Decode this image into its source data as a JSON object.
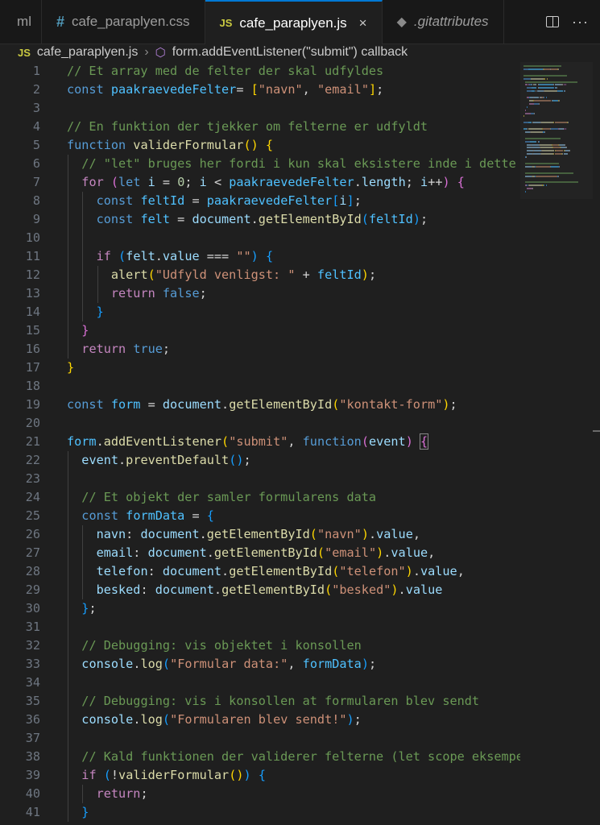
{
  "tabs": [
    {
      "label": "ml"
    },
    {
      "label": "cafe_paraplyen.css",
      "icon": "css-file-icon"
    },
    {
      "label": "cafe_paraplyen.js",
      "icon": "js-file-icon",
      "active": true
    },
    {
      "label": ".gitattributes",
      "icon": "git-file-icon"
    }
  ],
  "icons": {
    "css": "#",
    "js": "JS",
    "close": "×",
    "git": "◆",
    "more": "···",
    "cube": "⬡",
    "chevron": "›"
  },
  "breadcrumb": {
    "file": "cafe_paraplyen.js",
    "symbol": "form.addEventListener(\"submit\") callback"
  },
  "colors": {
    "accent": "#0078d4",
    "background": "#1f1f1f",
    "comment": "#6a9955",
    "keyword": "#569cd6",
    "string": "#ce9178"
  },
  "code": [
    {
      "n": "1",
      "t": [
        [
          "c",
          "// Et array med de felter der skal udfyldes"
        ]
      ]
    },
    {
      "n": "2",
      "t": [
        [
          "k",
          "const "
        ],
        [
          "cn",
          "paakraevedeFelter"
        ],
        [
          "",
          "= "
        ],
        [
          "p1",
          "["
        ],
        [
          "s",
          "\"navn\""
        ],
        [
          "",
          ", "
        ],
        [
          "s",
          "\"email\""
        ],
        [
          "p1",
          "]"
        ],
        [
          "",
          ";"
        ]
      ]
    },
    {
      "n": "3",
      "t": []
    },
    {
      "n": "4",
      "t": [
        [
          "c",
          "// En funktion der tjekker om felterne er udfyldt"
        ]
      ]
    },
    {
      "n": "5",
      "t": [
        [
          "k",
          "function "
        ],
        [
          "f",
          "validerFormular"
        ],
        [
          "p1",
          "()"
        ],
        [
          "",
          " "
        ],
        [
          "p1",
          "{"
        ]
      ]
    },
    {
      "n": "6",
      "g": [
        1
      ],
      "t": [
        [
          "",
          "  "
        ],
        [
          "c",
          "// \"let\" bruges her fordi i kun skal eksistere inde i dette"
        ]
      ]
    },
    {
      "n": "7",
      "g": [
        1
      ],
      "t": [
        [
          "",
          "  "
        ],
        [
          "kw",
          "for "
        ],
        [
          "p2",
          "("
        ],
        [
          "k",
          "let "
        ],
        [
          "v",
          "i"
        ],
        [
          "",
          " = "
        ],
        [
          "n",
          "0"
        ],
        [
          "",
          "; "
        ],
        [
          "v",
          "i"
        ],
        [
          "",
          " < "
        ],
        [
          "cn",
          "paakraevedeFelter"
        ],
        [
          "",
          "."
        ],
        [
          "v",
          "length"
        ],
        [
          "",
          "; "
        ],
        [
          "v",
          "i"
        ],
        [
          "",
          "++"
        ],
        [
          "p2",
          ")"
        ],
        [
          "",
          " "
        ],
        [
          "p2",
          "{"
        ]
      ]
    },
    {
      "n": "8",
      "g": [
        1,
        2
      ],
      "t": [
        [
          "",
          "    "
        ],
        [
          "k",
          "const "
        ],
        [
          "cn",
          "feltId"
        ],
        [
          "",
          " = "
        ],
        [
          "cn",
          "paakraevedeFelter"
        ],
        [
          "p3",
          "["
        ],
        [
          "v",
          "i"
        ],
        [
          "p3",
          "]"
        ],
        [
          "",
          ";"
        ]
      ]
    },
    {
      "n": "9",
      "g": [
        1,
        2
      ],
      "t": [
        [
          "",
          "    "
        ],
        [
          "k",
          "const "
        ],
        [
          "cn",
          "felt"
        ],
        [
          "",
          " = "
        ],
        [
          "v",
          "document"
        ],
        [
          "",
          "."
        ],
        [
          "f",
          "getElementById"
        ],
        [
          "p3",
          "("
        ],
        [
          "cn",
          "feltId"
        ],
        [
          "p3",
          ")"
        ],
        [
          "",
          ";"
        ]
      ]
    },
    {
      "n": "10",
      "g": [
        1,
        2
      ],
      "t": []
    },
    {
      "n": "11",
      "g": [
        1,
        2
      ],
      "t": [
        [
          "",
          "    "
        ],
        [
          "kw",
          "if "
        ],
        [
          "p3",
          "("
        ],
        [
          "v",
          "felt"
        ],
        [
          "",
          "."
        ],
        [
          "v",
          "value"
        ],
        [
          "",
          " === "
        ],
        [
          "s",
          "\"\""
        ],
        [
          "p3",
          ")"
        ],
        [
          "",
          " "
        ],
        [
          "p3",
          "{"
        ]
      ]
    },
    {
      "n": "12",
      "g": [
        1,
        2,
        3
      ],
      "t": [
        [
          "",
          "      "
        ],
        [
          "f",
          "alert"
        ],
        [
          "p1",
          "("
        ],
        [
          "s",
          "\"Udfyld venligst: \""
        ],
        [
          "",
          " + "
        ],
        [
          "cn",
          "feltId"
        ],
        [
          "p1",
          ")"
        ],
        [
          "",
          ";"
        ]
      ]
    },
    {
      "n": "13",
      "g": [
        1,
        2,
        3
      ],
      "t": [
        [
          "",
          "      "
        ],
        [
          "kw",
          "return "
        ],
        [
          "k",
          "false"
        ],
        [
          "",
          ";"
        ]
      ]
    },
    {
      "n": "14",
      "g": [
        1,
        2
      ],
      "t": [
        [
          "",
          "    "
        ],
        [
          "p3",
          "}"
        ]
      ]
    },
    {
      "n": "15",
      "g": [
        1
      ],
      "t": [
        [
          "",
          "  "
        ],
        [
          "p2",
          "}"
        ]
      ]
    },
    {
      "n": "16",
      "g": [
        1
      ],
      "t": [
        [
          "",
          "  "
        ],
        [
          "kw",
          "return "
        ],
        [
          "k",
          "true"
        ],
        [
          "",
          ";"
        ]
      ]
    },
    {
      "n": "17",
      "t": [
        [
          "p1",
          "}"
        ]
      ]
    },
    {
      "n": "18",
      "t": []
    },
    {
      "n": "19",
      "t": [
        [
          "k",
          "const "
        ],
        [
          "cn",
          "form"
        ],
        [
          "",
          " = "
        ],
        [
          "v",
          "document"
        ],
        [
          "",
          "."
        ],
        [
          "f",
          "getElementById"
        ],
        [
          "p1",
          "("
        ],
        [
          "s",
          "\"kontakt-form\""
        ],
        [
          "p1",
          ")"
        ],
        [
          "",
          ";"
        ]
      ]
    },
    {
      "n": "20",
      "t": []
    },
    {
      "n": "21",
      "t": [
        [
          "cn",
          "form"
        ],
        [
          "",
          "."
        ],
        [
          "f",
          "addEventListener"
        ],
        [
          "p1",
          "("
        ],
        [
          "s",
          "\"submit\""
        ],
        [
          "",
          ", "
        ],
        [
          "k",
          "function"
        ],
        [
          "p2",
          "("
        ],
        [
          "v",
          "event"
        ],
        [
          "p2",
          ")"
        ],
        [
          "",
          " "
        ],
        [
          "p2bm",
          "{"
        ]
      ]
    },
    {
      "n": "22",
      "g": [
        1
      ],
      "t": [
        [
          "",
          "  "
        ],
        [
          "v",
          "event"
        ],
        [
          "",
          "."
        ],
        [
          "f",
          "preventDefault"
        ],
        [
          "p3",
          "()"
        ],
        [
          "",
          ";"
        ]
      ]
    },
    {
      "n": "23",
      "g": [
        1
      ],
      "t": []
    },
    {
      "n": "24",
      "g": [
        1
      ],
      "t": [
        [
          "",
          "  "
        ],
        [
          "c",
          "// Et objekt der samler formularens data"
        ]
      ]
    },
    {
      "n": "25",
      "g": [
        1
      ],
      "t": [
        [
          "",
          "  "
        ],
        [
          "k",
          "const "
        ],
        [
          "cn",
          "formData"
        ],
        [
          "",
          " = "
        ],
        [
          "p3",
          "{"
        ]
      ]
    },
    {
      "n": "26",
      "g": [
        1,
        2
      ],
      "t": [
        [
          "",
          "    "
        ],
        [
          "v",
          "navn"
        ],
        [
          "",
          ": "
        ],
        [
          "v",
          "document"
        ],
        [
          "",
          "."
        ],
        [
          "f",
          "getElementById"
        ],
        [
          "p1",
          "("
        ],
        [
          "s",
          "\"navn\""
        ],
        [
          "p1",
          ")"
        ],
        [
          "",
          "."
        ],
        [
          "v",
          "value"
        ],
        [
          "",
          ","
        ]
      ]
    },
    {
      "n": "27",
      "g": [
        1,
        2
      ],
      "t": [
        [
          "",
          "    "
        ],
        [
          "v",
          "email"
        ],
        [
          "",
          ": "
        ],
        [
          "v",
          "document"
        ],
        [
          "",
          "."
        ],
        [
          "f",
          "getElementById"
        ],
        [
          "p1",
          "("
        ],
        [
          "s",
          "\"email\""
        ],
        [
          "p1",
          ")"
        ],
        [
          "",
          "."
        ],
        [
          "v",
          "value"
        ],
        [
          "",
          ","
        ]
      ]
    },
    {
      "n": "28",
      "g": [
        1,
        2
      ],
      "t": [
        [
          "",
          "    "
        ],
        [
          "v",
          "telefon"
        ],
        [
          "",
          ": "
        ],
        [
          "v",
          "document"
        ],
        [
          "",
          "."
        ],
        [
          "f",
          "getElementById"
        ],
        [
          "p1",
          "("
        ],
        [
          "s",
          "\"telefon\""
        ],
        [
          "p1",
          ")"
        ],
        [
          "",
          "."
        ],
        [
          "v",
          "value"
        ],
        [
          "",
          ","
        ]
      ]
    },
    {
      "n": "29",
      "g": [
        1,
        2
      ],
      "t": [
        [
          "",
          "    "
        ],
        [
          "v",
          "besked"
        ],
        [
          "",
          ": "
        ],
        [
          "v",
          "document"
        ],
        [
          "",
          "."
        ],
        [
          "f",
          "getElementById"
        ],
        [
          "p1",
          "("
        ],
        [
          "s",
          "\"besked\""
        ],
        [
          "p1",
          ")"
        ],
        [
          "",
          "."
        ],
        [
          "v",
          "value"
        ]
      ]
    },
    {
      "n": "30",
      "g": [
        1
      ],
      "t": [
        [
          "",
          "  "
        ],
        [
          "p3",
          "}"
        ],
        [
          "",
          ";"
        ]
      ]
    },
    {
      "n": "31",
      "g": [
        1
      ],
      "t": []
    },
    {
      "n": "32",
      "g": [
        1
      ],
      "t": [
        [
          "",
          "  "
        ],
        [
          "c",
          "// Debugging: vis objektet i konsollen"
        ]
      ]
    },
    {
      "n": "33",
      "g": [
        1
      ],
      "t": [
        [
          "",
          "  "
        ],
        [
          "v",
          "console"
        ],
        [
          "",
          "."
        ],
        [
          "f",
          "log"
        ],
        [
          "p3",
          "("
        ],
        [
          "s",
          "\"Formular data:\""
        ],
        [
          "",
          ", "
        ],
        [
          "cn",
          "formData"
        ],
        [
          "p3",
          ")"
        ],
        [
          "",
          ";"
        ]
      ]
    },
    {
      "n": "34",
      "g": [
        1
      ],
      "t": []
    },
    {
      "n": "35",
      "g": [
        1
      ],
      "t": [
        [
          "",
          "  "
        ],
        [
          "c",
          "// Debugging: vis i konsollen at formularen blev sendt"
        ]
      ]
    },
    {
      "n": "36",
      "g": [
        1
      ],
      "t": [
        [
          "",
          "  "
        ],
        [
          "v",
          "console"
        ],
        [
          "",
          "."
        ],
        [
          "f",
          "log"
        ],
        [
          "p3",
          "("
        ],
        [
          "s",
          "\"Formularen blev sendt!\""
        ],
        [
          "p3",
          ")"
        ],
        [
          "",
          ";"
        ]
      ]
    },
    {
      "n": "37",
      "g": [
        1
      ],
      "t": []
    },
    {
      "n": "38",
      "g": [
        1
      ],
      "t": [
        [
          "",
          "  "
        ],
        [
          "c",
          "// Kald funktionen der validerer felterne (let scope eksempe"
        ]
      ]
    },
    {
      "n": "39",
      "g": [
        1
      ],
      "t": [
        [
          "",
          "  "
        ],
        [
          "kw",
          "if "
        ],
        [
          "p3",
          "("
        ],
        [
          "",
          "!"
        ],
        [
          "f",
          "validerFormular"
        ],
        [
          "p1",
          "()"
        ],
        [
          "p3",
          ")"
        ],
        [
          "",
          " "
        ],
        [
          "p3",
          "{"
        ]
      ]
    },
    {
      "n": "40",
      "g": [
        1,
        2
      ],
      "t": [
        [
          "",
          "    "
        ],
        [
          "kw",
          "return"
        ],
        [
          "",
          ";"
        ]
      ]
    },
    {
      "n": "41",
      "g": [
        1
      ],
      "t": [
        [
          "",
          "  "
        ],
        [
          "p3",
          "}"
        ]
      ]
    }
  ]
}
